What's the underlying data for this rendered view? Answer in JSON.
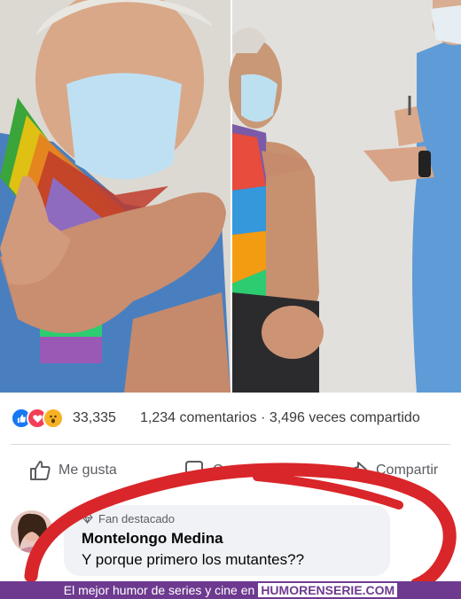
{
  "post": {
    "reaction_count": "33,335",
    "comments_shares": "1,234 comentarios · 3,496 veces compartido",
    "reactions": [
      "like-icon",
      "love-icon",
      "wow-icon"
    ]
  },
  "actions": {
    "like": "Me gusta",
    "comment": "Comentar",
    "share": "Compartir"
  },
  "comment": {
    "badge": "Fan destacado",
    "author": "Montelongo Medina",
    "text": "Y porque primero los mutantes??"
  },
  "banner": {
    "text": "El mejor humor de series y cine en",
    "brand": "HUMORENSERIE.COM"
  },
  "colors": {
    "accent_red": "#d9262a",
    "banner_bg": "#6d3a8f",
    "facebook_blue": "#1877f2"
  }
}
